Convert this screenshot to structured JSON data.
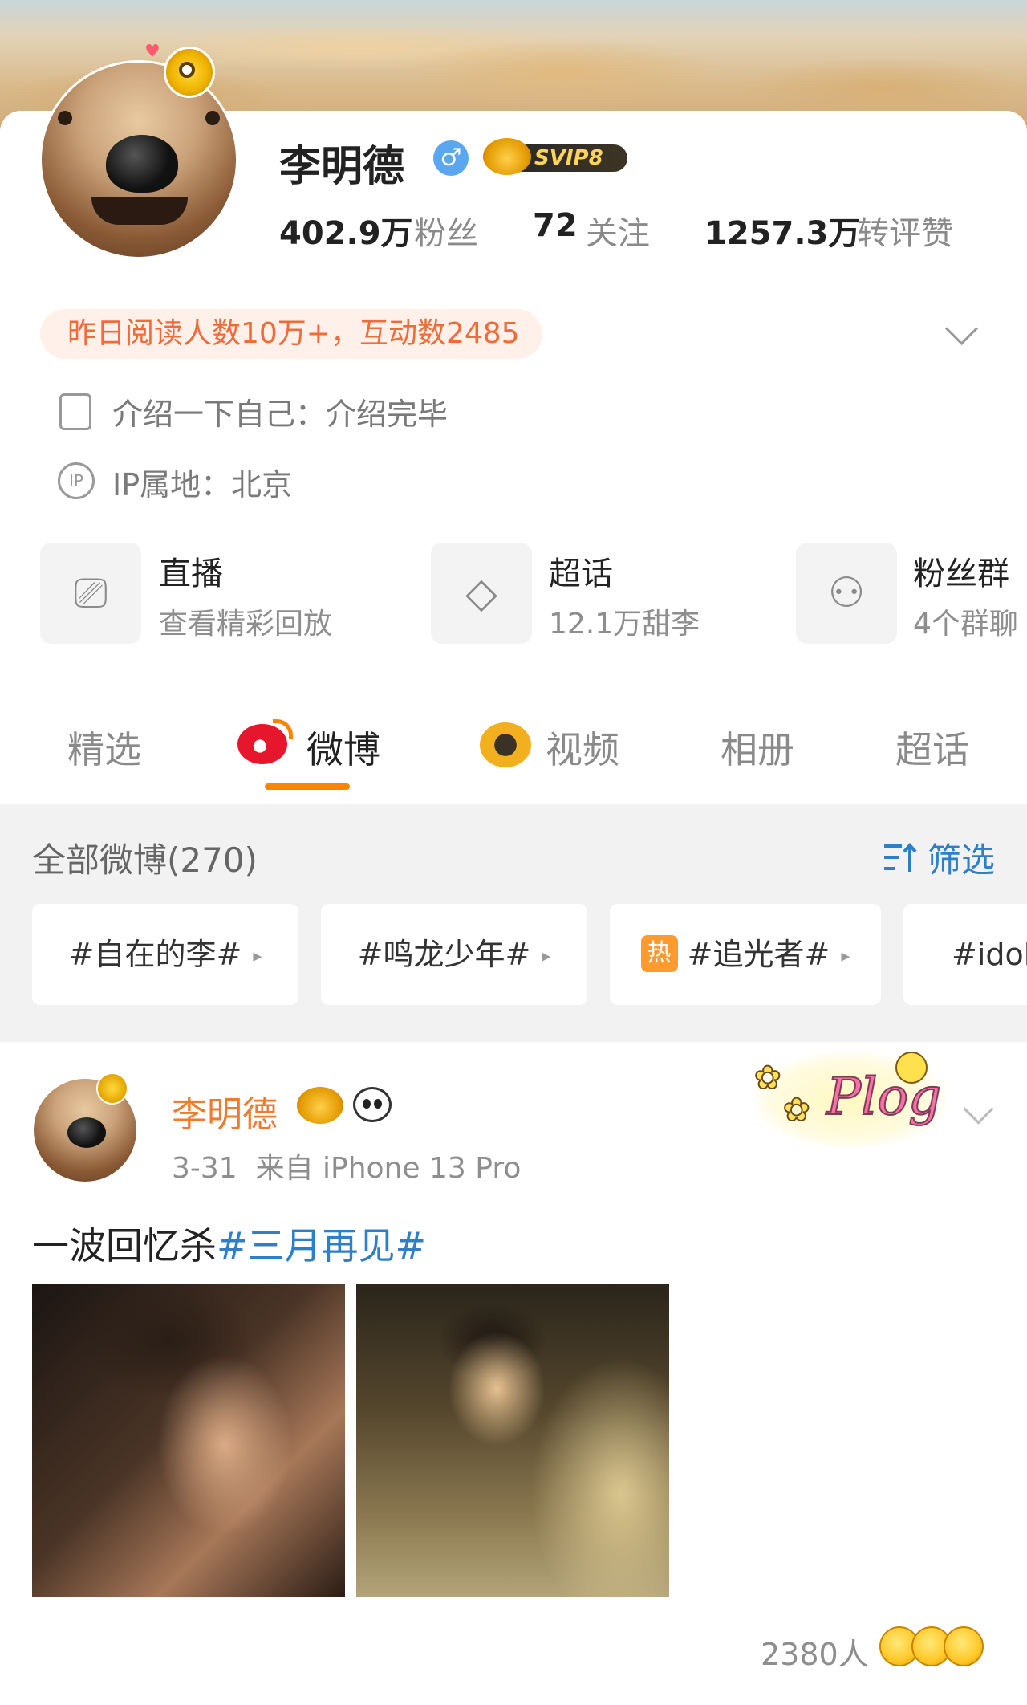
{
  "profile": {
    "name": "李明德",
    "gender_icon": "male-icon",
    "vip_badge": "SVIP8",
    "stats": [
      {
        "value": "402.9万",
        "label": "粉丝"
      },
      {
        "value": "72",
        "label": "关注"
      },
      {
        "value": "1257.3万",
        "label": "转评赞"
      }
    ],
    "read_summary": "昨日阅读人数10万+，互动数2485",
    "bio": "介绍一下自己：介绍完毕",
    "ip": "IP属地：北京"
  },
  "features": [
    {
      "title": "直播",
      "sub": "查看精彩回放",
      "icon": "tv-icon"
    },
    {
      "title": "超话",
      "sub": "12.1万甜李",
      "icon": "diamond-icon"
    },
    {
      "title": "粉丝群",
      "sub": "4个群聊",
      "icon": "group-icon"
    }
  ],
  "tabs": [
    {
      "label": "精选"
    },
    {
      "label": "微博"
    },
    {
      "label": "视频"
    },
    {
      "label": "相册"
    },
    {
      "label": "超话"
    }
  ],
  "feed_header": {
    "all": "全部微博(270)",
    "filter": "筛选"
  },
  "topics": [
    {
      "label": "#自在的李#"
    },
    {
      "label": "#鸣龙少年#"
    },
    {
      "label": "#追光者#",
      "badge": "热"
    },
    {
      "label": "#idol"
    }
  ],
  "post": {
    "author": "李明德",
    "meta": "3-31  来自 iPhone 13 Pro",
    "text_plain": "一波回忆杀",
    "text_tag": "#三月再见#",
    "sticker": "Plog",
    "reactions": "2380人"
  },
  "colors": {
    "accent": "#ff8200",
    "link": "#2f7fc8",
    "name_orange": "#f07b2c"
  }
}
